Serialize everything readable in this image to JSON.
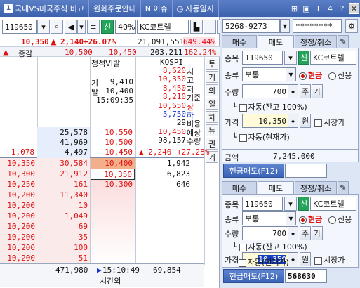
{
  "topbar": {
    "num": "1",
    "items": [
      "국내VS미국주식 비교",
      "원화주문안내",
      "N 이슈",
      "자동일지"
    ],
    "icons": [
      "pin-icon",
      "text-icon",
      "t-icon",
      "num4-icon",
      "help-icon",
      "close-icon"
    ],
    "icon_glyphs": [
      "⊞",
      "▣",
      "T",
      "4",
      "?",
      "✕"
    ]
  },
  "left": {
    "code": "119650",
    "credit_badge": "신",
    "margin_rate": "40%",
    "stock_name": "KC코트렐",
    "price": "10,350",
    "arrow": "▲",
    "change": "2,140",
    "change_pct": "+26.07%",
    "volume": "21,091,551",
    "vol_pct": "649.44%",
    "header": {
      "label": "증감",
      "col2": "10,500",
      "col3": "10,450",
      "col4": "203,211",
      "col5": "162.24%"
    },
    "info_box": {
      "title": "정적VI발",
      "rows": [
        {
          "k": "기",
          "v": "9,410"
        },
        {
          "k": "발",
          "v": "10,400"
        },
        {
          "k": "",
          "v": "15:09:35"
        }
      ]
    },
    "kospi": {
      "title": "KOSPI",
      "values": [
        "8,620",
        "10,350",
        "8,450",
        "8,210",
        "10,650",
        "5,750",
        "29",
        "10,450",
        "98,157"
      ],
      "labels": [
        "시",
        "고",
        "저",
        "기준",
        "상",
        "하",
        "비용",
        "예상",
        "수량"
      ]
    },
    "expected_change": "▲ 2,240",
    "expected_pct": "+27.28%",
    "side_tabs": [
      "투",
      "거",
      "외",
      "일",
      "차",
      "뉴",
      "권",
      "기"
    ],
    "asks": [
      {
        "qty": "25,578",
        "price": "10,550"
      },
      {
        "qty": "41,969",
        "price": "10,500"
      },
      {
        "change": "1,078",
        "qty": "4,497",
        "price": "10,450"
      }
    ],
    "trades": [
      {
        "price": "10,350",
        "qty": "30,584"
      },
      {
        "price": "10,300",
        "qty": "21,912"
      },
      {
        "price": "10,250",
        "qty": "161"
      },
      {
        "price": "10,200",
        "qty": "11,340"
      },
      {
        "price": "10,200",
        "qty": "10"
      },
      {
        "price": "10,200",
        "qty": "1,049"
      },
      {
        "price": "10,200",
        "qty": "69"
      },
      {
        "price": "10,200",
        "qty": "35"
      },
      {
        "price": "10,200",
        "qty": "100"
      },
      {
        "price": "10,200",
        "qty": "51"
      }
    ],
    "bids": [
      {
        "price": "10,400",
        "qty": "1,942"
      },
      {
        "price": "10,350",
        "qty": "6,823"
      },
      {
        "price": "10,300",
        "qty": "646"
      }
    ],
    "footer": {
      "total_left": "471,980",
      "time": "15:10:49",
      "time_label": "시간외",
      "total_right": "69,854"
    }
  },
  "right": {
    "account": "5268-9273",
    "password": "********",
    "top_form": {
      "tabs": [
        "매수",
        "매도",
        "정정/취소"
      ],
      "code_label": "종목",
      "code": "119650",
      "credit": "신",
      "name": "KC코트렐",
      "type_label": "종류",
      "type": "보통",
      "cash": "현금",
      "credit_opt": "신용",
      "qty_label": "수량",
      "qty": "700",
      "qty_btn1": "주",
      "qty_btn2": "가",
      "auto_remain": "자동(잔고 100%)",
      "price_label": "가격",
      "price": "10,350",
      "price_unit": "원",
      "market": "시장가",
      "auto_cur": "자동(현재가)",
      "amount_label": "금액",
      "amount": "7,245,000",
      "submit": "현금매도(F12)"
    },
    "bottom_form": {
      "tabs": [
        "매수",
        "매도",
        "정정/취소"
      ],
      "code_label": "종목",
      "code": "119650",
      "credit": "신",
      "name": "KC코트렐",
      "type_label": "종류",
      "type": "보통",
      "cash": "현금",
      "credit_opt": "신용",
      "qty_label": "수량",
      "qty": "700",
      "qty_btn1": "주",
      "qty_btn2": "가",
      "auto_remain": "자동(잔고 100%)",
      "price_label": "가격",
      "price": "10,350",
      "price_unit": "원",
      "market": "시장가",
      "auto_cur": "자동(현재가)",
      "submit": "현금매도(F12)",
      "order_no": "568630"
    }
  }
}
